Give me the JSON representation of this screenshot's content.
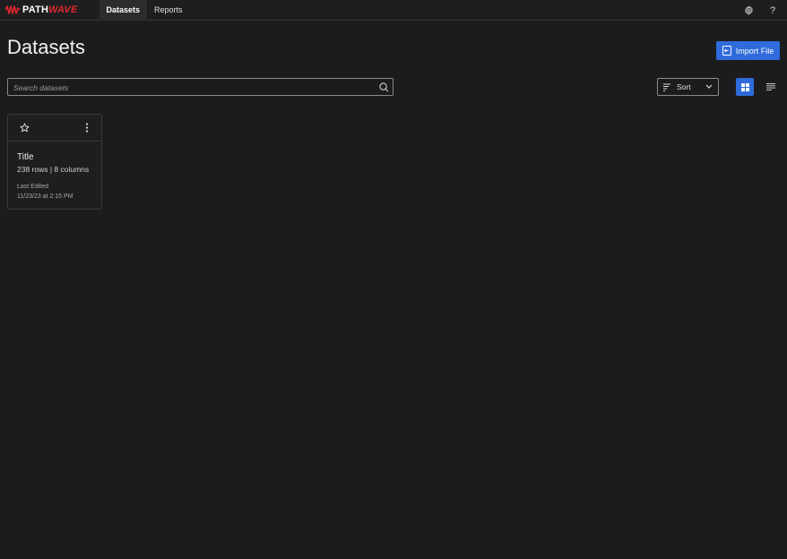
{
  "brand": {
    "name_part1": "PATH",
    "name_part2": "WAVE",
    "accent": "#e0262e"
  },
  "nav": {
    "tabs": [
      {
        "label": "Datasets",
        "active": true
      },
      {
        "label": "Reports",
        "active": false
      }
    ]
  },
  "topbar": {
    "settings_icon": "gear-icon",
    "help_icon": "question-mark-icon"
  },
  "page": {
    "title": "Datasets"
  },
  "toolbar": {
    "import_label": "Import File",
    "search_placeholder": "Search datasets",
    "search_value": "",
    "sort_label": "Sort",
    "view_mode": "grid",
    "primary_color": "#2f6bdb"
  },
  "datasets": [
    {
      "title": "Title",
      "summary": "238 rows | 8 columns",
      "last_edited_label": "Last Edited",
      "last_edited": "11/23/23 at 2:15 PM",
      "starred": false
    }
  ]
}
